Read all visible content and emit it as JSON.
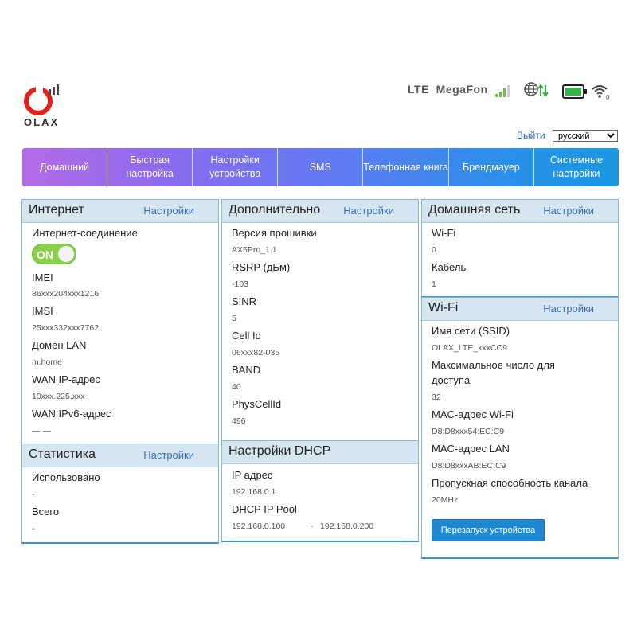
{
  "brand": {
    "logo_text": "OLAX"
  },
  "status": {
    "network": "LTE  MegaFon"
  },
  "header": {
    "logout": "Выйти",
    "language": "русский"
  },
  "nav": [
    "Домашний",
    "Быстрая настройка",
    "Настройки устройства",
    "SMS",
    "Телефонная книга",
    "Брендмауер",
    "Системные настройки"
  ],
  "internet": {
    "title": "Интернет",
    "settings": "Настройки",
    "connection_label": "Интернет-соединение",
    "toggle": "ON",
    "imei_label": "IMEI",
    "imei": "86xxx204xxx1216",
    "imsi_label": "IMSI",
    "imsi": "25xxx332xxx7762",
    "lan_domain_label": "Домен LAN",
    "lan_domain": "m.home",
    "wan_ip_label": "WAN IP-адрес",
    "wan_ip": "10xxx.225.xxx",
    "wan_ipv6_label": "WAN IPv6-адрес",
    "wan_ipv6": "— —"
  },
  "stats": {
    "title": "Статистика",
    "settings": "Настройки",
    "used_label": "Использовано",
    "used": "-",
    "total_label": "Всего",
    "total": "-"
  },
  "extra": {
    "title": "Дополнительно",
    "settings": "Настройки",
    "firmware_label": "Версия прошивки",
    "firmware": "AX5Pro_1.1",
    "rsrp_label": "RSRP (дБм)",
    "rsrp": "-103",
    "sinr_label": "SINR",
    "sinr": "5",
    "cellid_label": "Cell Id",
    "cellid": "06xxx82-035",
    "band_label": "BAND",
    "band": "40",
    "pci_label": "PhysCellId",
    "pci": "496"
  },
  "dhcp": {
    "title": "Настройки DHCP",
    "ip_label": "IP адрес",
    "ip": "192.168.0.1",
    "pool_label": "DHCP IP Pool",
    "pool_start": "192.168.0.100",
    "pool_sep": "-",
    "pool_end": "192.168.0.200"
  },
  "home_net": {
    "title": "Домашняя сеть",
    "settings": "Настройки",
    "wifi_label": "Wi-Fi",
    "wifi": "0",
    "cable_label": "Кабель",
    "cable": "1"
  },
  "wifi": {
    "title": "Wi-Fi",
    "settings": "Настройки",
    "ssid_label": "Имя сети (SSID)",
    "ssid": "OLAX_LTE_xxxCC9",
    "max_label_1": "Максимальное число для",
    "max_label_2": "доступа",
    "max": "32",
    "mac_wifi_label": "MAC-адрес Wi-Fi",
    "mac_wifi": "D8:D8xxx54:EC:C9",
    "mac_lan_label": "MAC-адрес LAN",
    "mac_lan": "D8:D8xxxAB:EC:C9",
    "bandwidth_label": "Пропускная способность канала",
    "bandwidth": "20MHz",
    "restart": "Перезапуск устройства"
  },
  "colors": {
    "accent": "#3d94c4",
    "toggle_on": "#8bd04a",
    "signal": "#6cc04a",
    "battery": "#33b54a",
    "logo": "#e0231d"
  },
  "icons": [
    "signal-icon",
    "globe-icon",
    "battery-icon",
    "wifi-icon"
  ]
}
